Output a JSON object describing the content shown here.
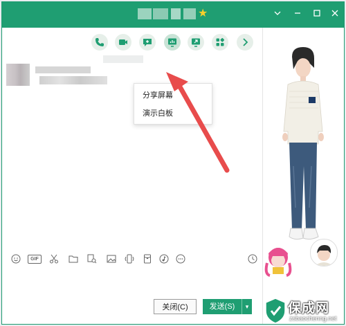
{
  "titlebar": {
    "title": "",
    "controls": [
      "chevron-down-icon",
      "minimize-icon",
      "maximize-icon",
      "close-icon"
    ]
  },
  "toolbar": {
    "buttons": [
      "phone-icon",
      "video-icon",
      "add-chat-icon",
      "screen-share-icon",
      "remote-assist-icon",
      "apps-icon",
      "chevron-right-icon"
    ]
  },
  "menu": {
    "share_screen": "分享屏幕",
    "present_whiteboard": "演示白板"
  },
  "input_toolbar": {
    "icons": [
      "emoji-icon",
      "gif-icon",
      "scissors-icon",
      "folder-icon",
      "image-search-icon",
      "picture-icon",
      "vibrate-icon",
      "hongbao-icon",
      "music-icon",
      "more-icon",
      "history-icon"
    ],
    "gif_label": "GIF"
  },
  "actions": {
    "close_label": "关闭(C)",
    "send_label": "发送(S)"
  },
  "watermark": {
    "text": "保成网",
    "url": "zsbaochenng.net"
  },
  "colors": {
    "accent": "#1f9e72",
    "arrow": "#e84c4c"
  }
}
